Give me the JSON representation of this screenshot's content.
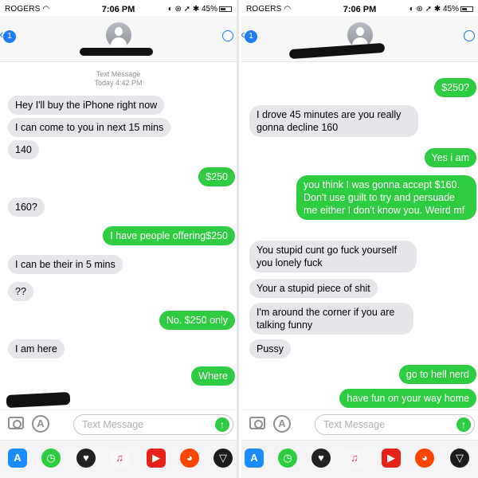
{
  "status_bar": {
    "left_carrier": "ROGERS",
    "right_carrier": "ROGERS",
    "time": "7:06 PM",
    "battery": "45%",
    "battery_level": 0.45
  },
  "nav": {
    "back_badge": "1"
  },
  "thread_header": {
    "line1": "Text Message",
    "line2": "Today 4:42 PM"
  },
  "left_messages": [
    {
      "dir": "in",
      "text": "Hey I'll buy the iPhone right now"
    },
    {
      "dir": "in",
      "text": "I can come to you in next 15 mins"
    },
    {
      "dir": "in",
      "text": "140"
    },
    {
      "dir": "out",
      "text": "$250"
    },
    {
      "dir": "in",
      "text": "160?"
    },
    {
      "dir": "out",
      "text": "I have people offering$250"
    },
    {
      "dir": "in",
      "text": "I can be their in 5 mins"
    },
    {
      "dir": "in",
      "text": "??"
    },
    {
      "dir": "out",
      "text": "No. $250 only"
    },
    {
      "dir": "in",
      "text": "I am here"
    },
    {
      "dir": "out",
      "text": "Where"
    }
  ],
  "right_messages": [
    {
      "dir": "out",
      "text": "$250?"
    },
    {
      "dir": "in",
      "text": "I drove 45 minutes are you really gonna decline 160"
    },
    {
      "dir": "out",
      "text": "Yes i am"
    },
    {
      "dir": "out",
      "text": "you think I was gonna accept $160. Don't use guilt to try and persuade me either I don't know you. Weird mf"
    },
    {
      "dir": "in",
      "text": "You stupid cunt go fuck yourself you lonely fuck"
    },
    {
      "dir": "in",
      "text": "Your a stupid piece of shit"
    },
    {
      "dir": "in",
      "text": "I'm around the corner if you are talking funny"
    },
    {
      "dir": "in",
      "text": "Pussy"
    },
    {
      "dir": "out",
      "text": "go to hell nerd"
    },
    {
      "dir": "out",
      "text": "have fun on your way home"
    }
  ],
  "input": {
    "placeholder": "Text Message"
  },
  "app_drawer": [
    {
      "icon": "app-store-icon",
      "color": "#1a8cff"
    },
    {
      "icon": "clock-icon",
      "color": "#2ecc40"
    },
    {
      "icon": "heart-icon",
      "color": "#222222"
    },
    {
      "icon": "music-icon",
      "color": "#f7f7f7"
    },
    {
      "icon": "youtube-icon",
      "color": "#e62117"
    },
    {
      "icon": "reddit-icon",
      "color": "#ff4500"
    },
    {
      "icon": "destiny-icon",
      "color": "#1b1b1b"
    }
  ],
  "colors": {
    "outgoing_bubble": "#2ecc40",
    "incoming_bubble": "#e5e5ea",
    "ios_blue": "#1e7cf7"
  }
}
